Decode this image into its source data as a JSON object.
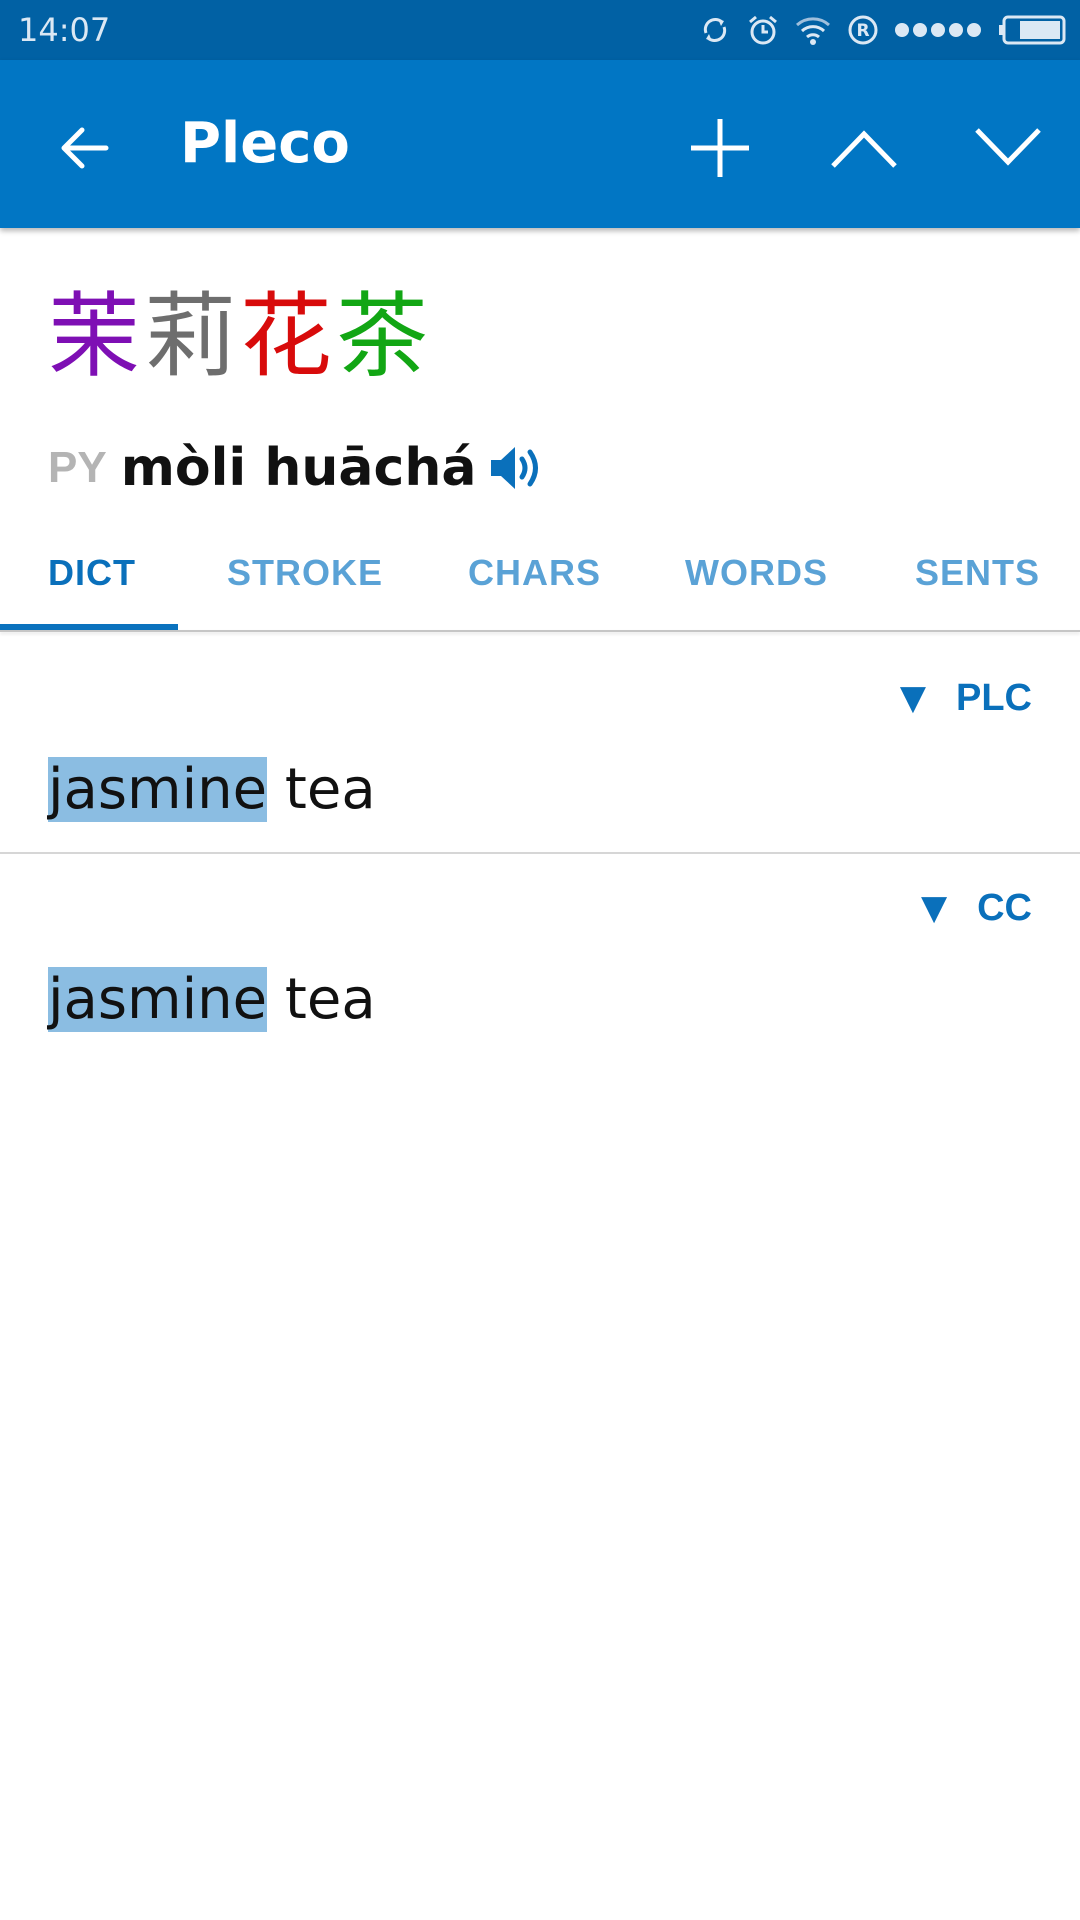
{
  "status_bar": {
    "time": "14:07",
    "icons": [
      "sync-icon",
      "alarm-icon",
      "wifi-icon",
      "registered-icon",
      "signal-dots-icon",
      "battery-icon"
    ]
  },
  "app_bar": {
    "title": "Pleco",
    "icons": [
      "back-arrow-icon",
      "add-icon",
      "chevron-up-icon",
      "chevron-down-icon"
    ],
    "color": "#0176c4"
  },
  "headword": {
    "characters": [
      {
        "char": "茉",
        "color": "#7e0fb4"
      },
      {
        "char": "莉",
        "color": "#6e6e6e"
      },
      {
        "char": "花",
        "color": "#d80b0b"
      },
      {
        "char": "茶",
        "color": "#12a614"
      }
    ],
    "pinyin_tag": "PY",
    "pinyin": "mòli huāchá"
  },
  "tabs": [
    {
      "label": "DICT",
      "active": true
    },
    {
      "label": "STROKE",
      "active": false
    },
    {
      "label": "CHARS",
      "active": false
    },
    {
      "label": "WORDS",
      "active": false
    },
    {
      "label": "SENTS",
      "active": false
    }
  ],
  "entries": [
    {
      "dictionary": "PLC",
      "highlight": "jasmine",
      "rest": " tea"
    },
    {
      "dictionary": "CC",
      "highlight": "jasmine",
      "rest": " tea"
    }
  ],
  "colors": {
    "accent": "#0a70bb",
    "tab_inactive": "#5aa2d6",
    "highlight": "#8bbde2"
  }
}
